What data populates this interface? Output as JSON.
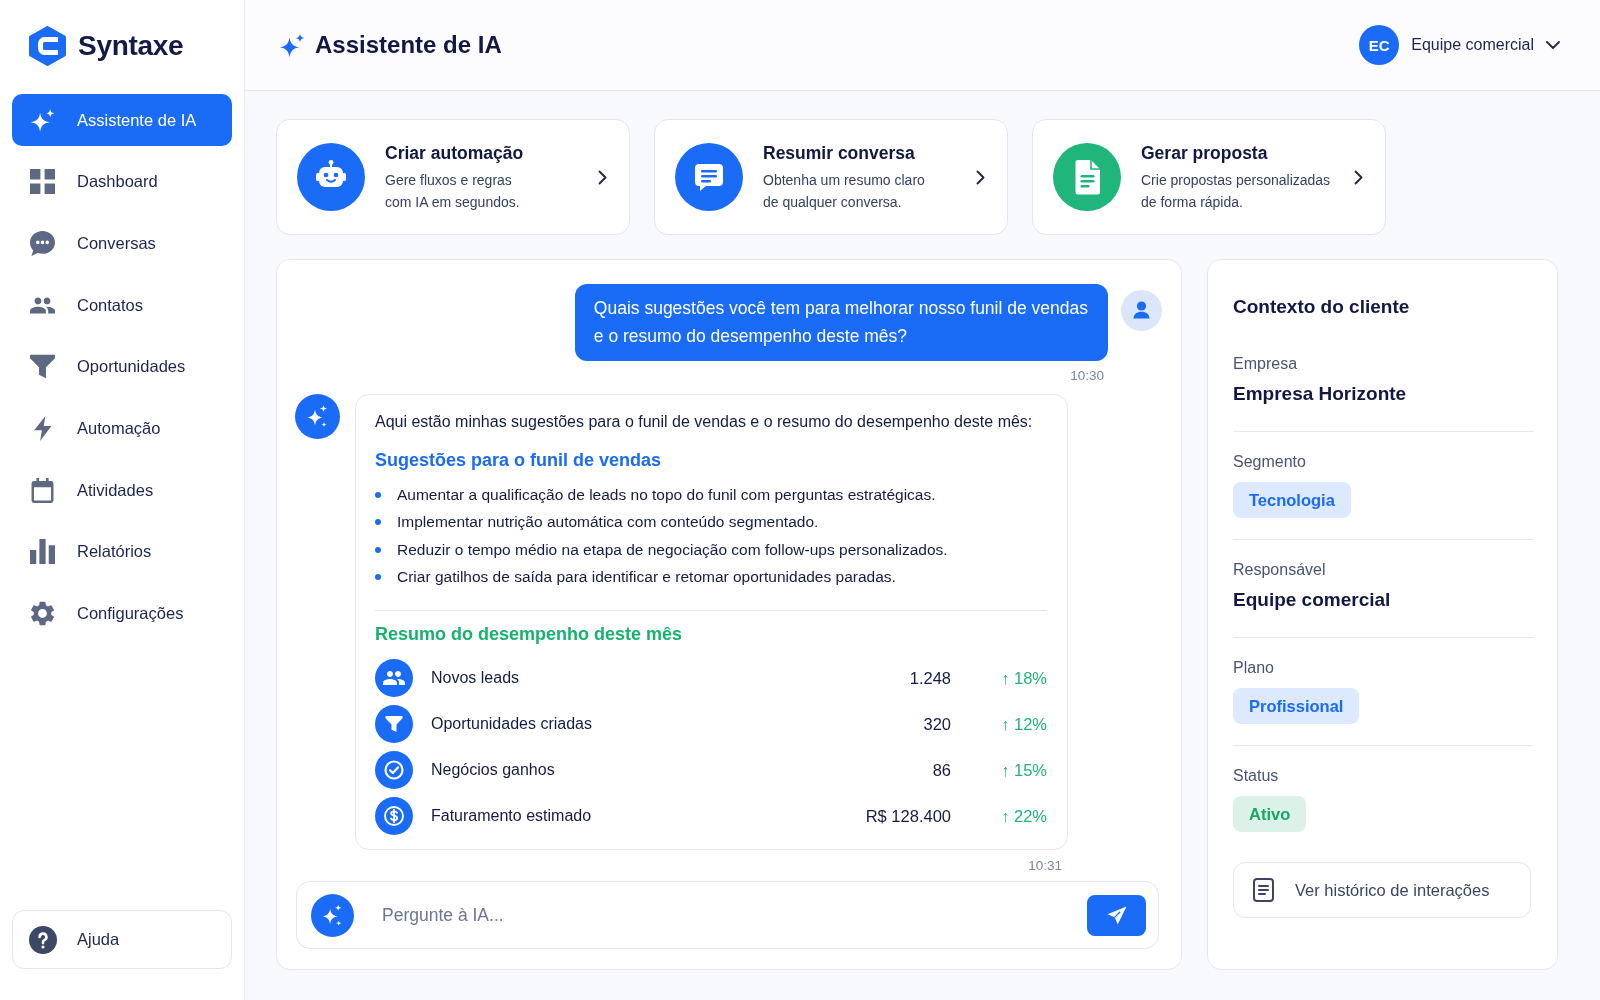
{
  "sidebar": {
    "logo": "Syntaxe",
    "items": [
      {
        "label": "Assistente de IA",
        "selected": true
      },
      {
        "label": "Dashboard",
        "selected": false
      },
      {
        "label": "Conversas",
        "selected": false
      },
      {
        "label": "Contatos",
        "selected": false
      },
      {
        "label": "Oportunidades",
        "selected": false
      },
      {
        "label": "Automação",
        "selected": false
      },
      {
        "label": "Atividades",
        "selected": false
      },
      {
        "label": "Relatórios",
        "selected": false
      },
      {
        "label": "Configurações",
        "selected": false
      }
    ],
    "help": {
      "label": "Ajuda"
    }
  },
  "header": {
    "title": "Assistente de IA",
    "user": {
      "initials": "EC",
      "name": "Equipe comercial"
    }
  },
  "quick_actions": [
    {
      "title": "Criar automação",
      "description": [
        "Gere fluxos e regras",
        "com IA em segundos."
      ],
      "color": "#1a6bf5"
    },
    {
      "title": "Resumir conversa",
      "description": [
        "Obtenha um resumo claro",
        "de qualquer conversa."
      ],
      "color": "#1a6bf5"
    },
    {
      "title": "Gerar proposta",
      "description": [
        "Crie propostas personalizadas",
        "de forma rápida."
      ],
      "color": "#1fb57b"
    }
  ],
  "chat": {
    "messages": [
      {
        "kind": "user",
        "lines": [
          "Quais sugestões você tem para melhorar nosso funil de vendas",
          "e o resumo do desempenho deste mês?"
        ],
        "time": "10:30"
      },
      {
        "kind": "assistant",
        "intro": "Aqui estão minhas sugestões para o funil de vendas e o resumo do desempenho deste mês:",
        "sections": [
          {
            "kind": "list",
            "title": "Sugestões para o funil de vendas",
            "items": [
              "Aumentar a qualificação de leads no topo do funil com perguntas estratégicas.",
              "Implementar nutrição automática com conteúdo segmentado.",
              "Reduzir o tempo médio na etapa de negociação com follow-ups personalizados.",
              "Criar gatilhos de saída para identificar e retomar oportunidades paradas."
            ]
          },
          {
            "kind": "metrics",
            "title": "Resumo do desempenho deste mês",
            "rows": [
              {
                "label": "Novos leads",
                "value": "1.248",
                "change": "↑ 18%"
              },
              {
                "label": "Oportunidades criadas",
                "value": "320",
                "change": "↑ 12%"
              },
              {
                "label": "Negócios ganhos",
                "value": "86",
                "change": "↑ 15%"
              },
              {
                "label": "Faturamento estimado",
                "value": "R$ 128.400",
                "change": "↑ 22%"
              }
            ]
          }
        ],
        "time": "10:31"
      }
    ],
    "input": {
      "placeholder": "Pergunte à IA..."
    }
  },
  "client_context": {
    "title": "Contexto do cliente",
    "fields": [
      {
        "label": "Empresa",
        "kind": "text",
        "value": "Empresa Horizonte"
      },
      {
        "label": "Segmento",
        "kind": "tag",
        "value": "Tecnologia",
        "color": "#1a6bf5"
      },
      {
        "label": "Responsável",
        "kind": "text",
        "value": "Equipe comercial"
      },
      {
        "label": "Plano",
        "kind": "tag",
        "value": "Profissional",
        "color": "#1a6bf5"
      },
      {
        "label": "Status",
        "kind": "tag",
        "value": "Ativo",
        "color": "#16a865"
      }
    ],
    "history_button": {
      "label": "Ver histórico de interações"
    }
  }
}
